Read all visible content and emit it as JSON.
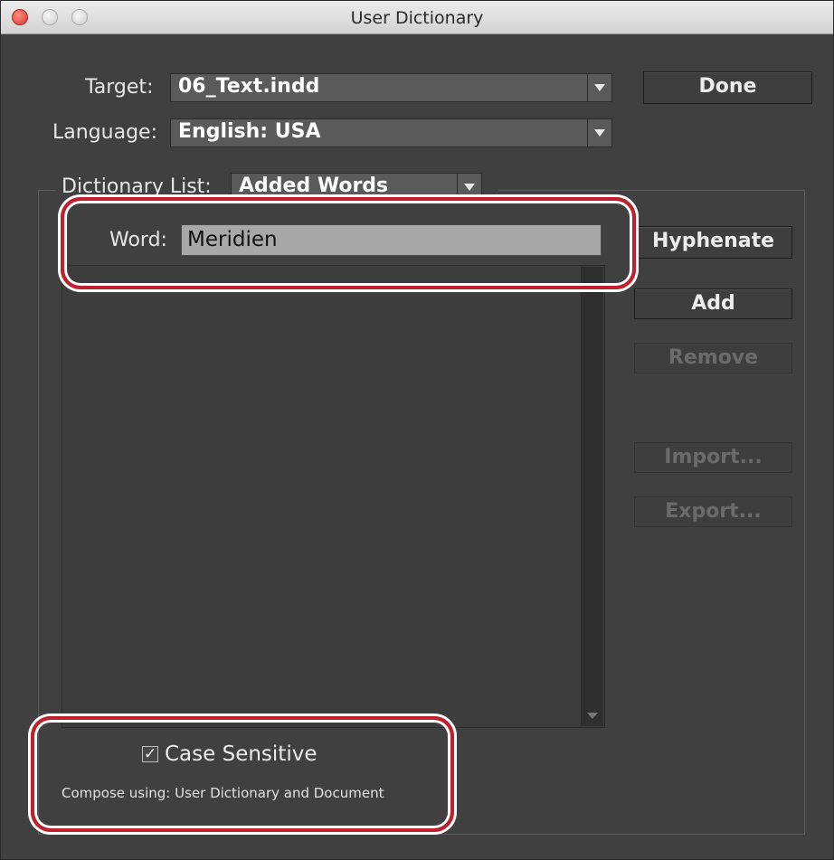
{
  "window": {
    "title": "User Dictionary"
  },
  "target": {
    "label": "Target:",
    "value": "06_Text.indd"
  },
  "language": {
    "label": "Language:",
    "value": "English: USA"
  },
  "buttons": {
    "done": "Done",
    "hyphenate": "Hyphenate",
    "add": "Add",
    "remove": "Remove",
    "import": "Import...",
    "export": "Export..."
  },
  "dictionary_list": {
    "label": "Dictionary List:",
    "value": "Added Words"
  },
  "word": {
    "label": "Word:",
    "value": "Meridien"
  },
  "word_list": {
    "items": []
  },
  "case_sensitive": {
    "label": "Case Sensitive",
    "checked": true,
    "check_glyph": "✓"
  },
  "compose": {
    "text": "Compose using: User Dictionary and Document"
  },
  "colors": {
    "dialog_bg": "#404040",
    "highlight_ring": "#c0202b",
    "disabled_text": "#6b6b6b"
  }
}
